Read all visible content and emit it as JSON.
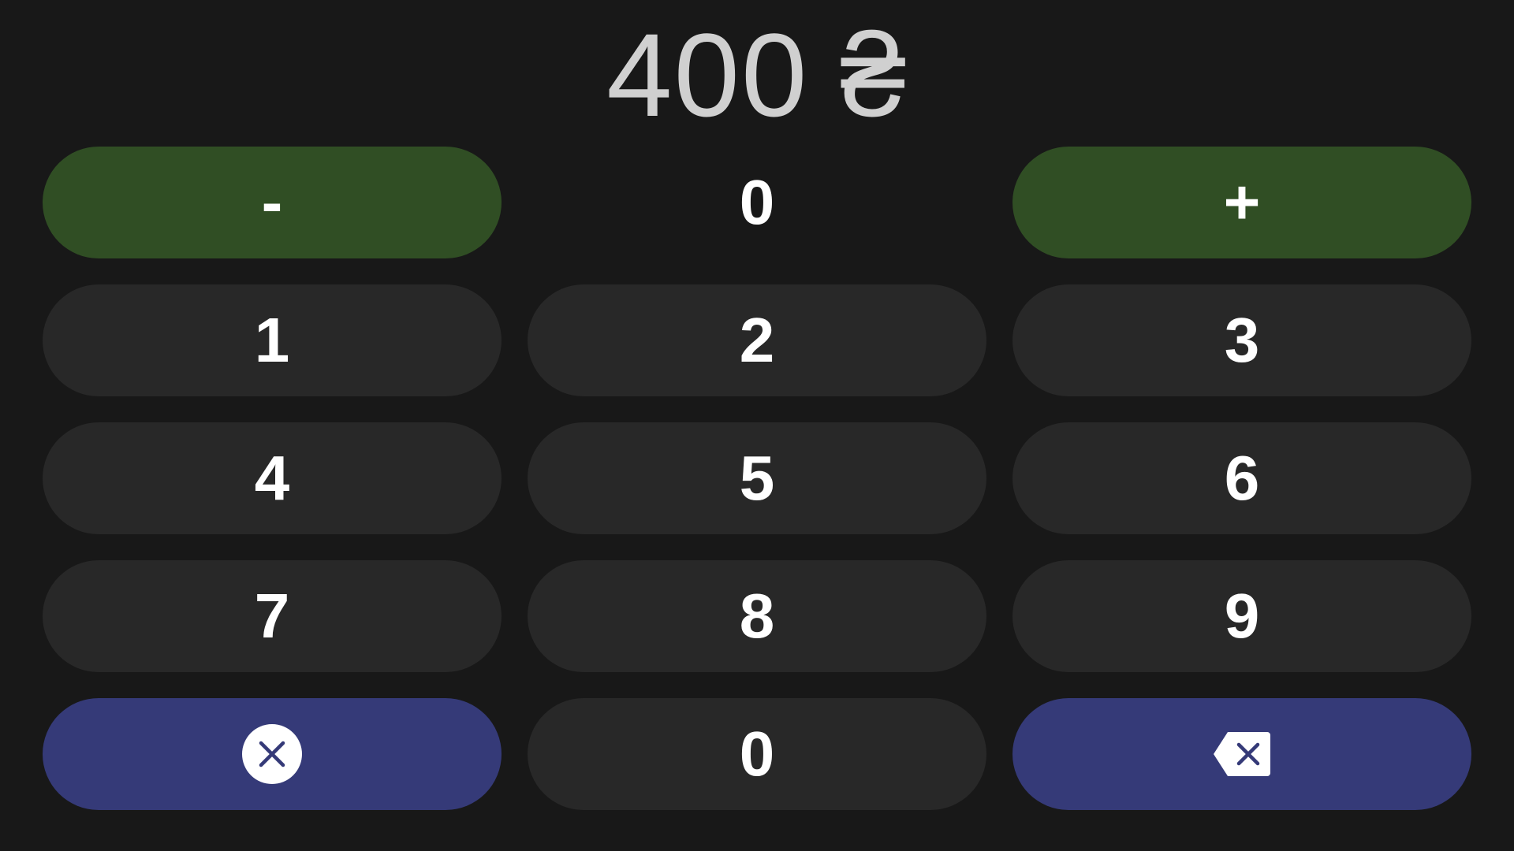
{
  "display": {
    "amount": "400",
    "currency": "₴"
  },
  "keypad": {
    "minus_label": "-",
    "current_step": "0",
    "plus_label": "+",
    "digits": [
      "1",
      "2",
      "3",
      "4",
      "5",
      "6",
      "7",
      "8",
      "9"
    ],
    "zero_label": "0",
    "clear_icon": "clear-circle-x-icon",
    "backspace_icon": "backspace-icon"
  },
  "colors": {
    "background": "#181818",
    "key": "#282828",
    "green": "#304e24",
    "blue": "#353a78",
    "display_text": "#d0d0d0",
    "key_text": "#ffffff"
  }
}
